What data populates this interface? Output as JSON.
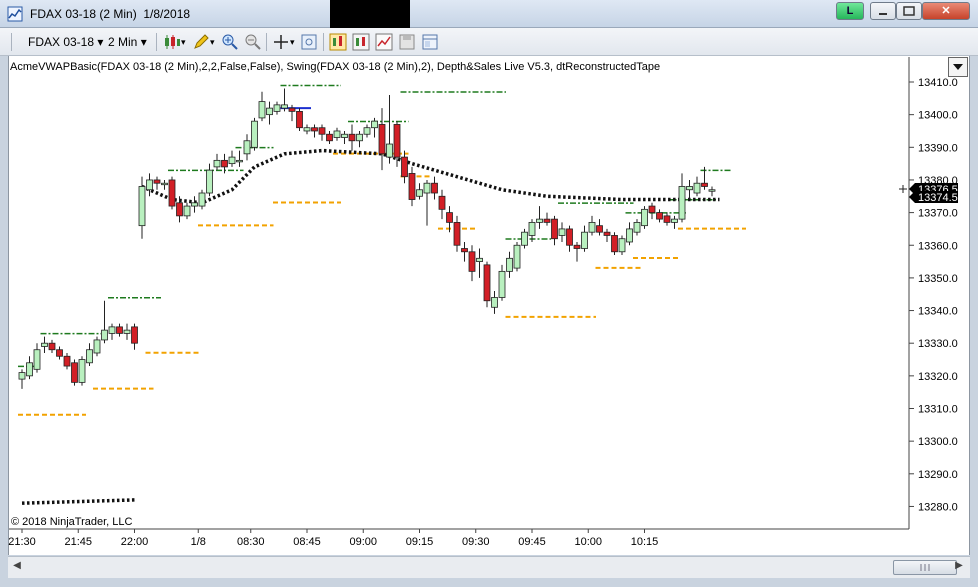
{
  "window": {
    "title": "FDAX 03-18 (2 Min)  1/8/2018",
    "link_button": "L",
    "min_icon": "minimize-icon",
    "max_icon": "maximize-icon",
    "close_label": "✕"
  },
  "toolbar": {
    "instrument": "FDAX 03-18",
    "interval": "2 Min",
    "icons": [
      "bar-type-icon",
      "draw-pencil-icon",
      "zoom-in-icon",
      "zoom-out-icon",
      "crosshair-icon",
      "properties-icon",
      "strategy-icon",
      "indicators-icon",
      "chart-trader-icon",
      "save-icon",
      "templates-icon"
    ]
  },
  "indicator_label": "AcmeVWAPBasic(FDAX 03-18 (2 Min),2,2,False,False), Swing(FDAX 03-18 (2 Min),2), Depth&Sales Live V5.3, dtReconstructedTape",
  "copyright": "© 2018 NinjaTrader, LLC",
  "colors": {
    "up_candle": "#b9f0bf",
    "down_candle": "#d21f26",
    "vwap": "#111111",
    "swing_high": "#1e7a1e",
    "swing_low": "#f2a200",
    "price_tag_bg": "#000000",
    "price_tag_fg": "#ffffff"
  },
  "chart_data": {
    "type": "candlestick",
    "title": "",
    "ylim": [
      13274,
      13414
    ],
    "yticks": [
      13280,
      13290,
      13300,
      13310,
      13320,
      13330,
      13340,
      13350,
      13360,
      13370,
      13380,
      13390,
      13400,
      13410
    ],
    "ytick_labels": [
      "13280.0",
      "13290.0",
      "13300.0",
      "13310.0",
      "13320.0",
      "13330.0",
      "13340.0",
      "13350.0",
      "13360.0",
      "13370.0",
      "13380.0",
      "13390.0",
      "13400.0",
      "13410.0"
    ],
    "xtick_labels": [
      "21:30",
      "21:45",
      "22:00",
      "1/8",
      "08:30",
      "08:45",
      "09:00",
      "09:15",
      "09:30",
      "09:45",
      "10:00",
      "10:15"
    ],
    "xtick_bars": [
      0,
      7.5,
      15,
      23.5,
      30.5,
      38,
      45.5,
      53,
      60.5,
      68,
      75.5,
      83
    ],
    "last_price_labels": [
      "13376.5",
      "13374.5"
    ],
    "candles": [
      {
        "o": 13319,
        "h": 13322,
        "l": 13316,
        "c": 13321
      },
      {
        "o": 13320,
        "h": 13326,
        "l": 13319,
        "c": 13324
      },
      {
        "o": 13322,
        "h": 13330,
        "l": 13321,
        "c": 13328
      },
      {
        "o": 13329,
        "h": 13332,
        "l": 13327,
        "c": 13330
      },
      {
        "o": 13330,
        "h": 13331,
        "l": 13327,
        "c": 13328
      },
      {
        "o": 13328,
        "h": 13329,
        "l": 13325,
        "c": 13326
      },
      {
        "o": 13326,
        "h": 13327,
        "l": 13322,
        "c": 13323
      },
      {
        "o": 13324,
        "h": 13325,
        "l": 13317,
        "c": 13318
      },
      {
        "o": 13318,
        "h": 13326,
        "l": 13317,
        "c": 13325
      },
      {
        "o": 13324,
        "h": 13330,
        "l": 13323,
        "c": 13328
      },
      {
        "o": 13327,
        "h": 13332,
        "l": 13326,
        "c": 13331
      },
      {
        "o": 13331,
        "h": 13343,
        "l": 13330,
        "c": 13334
      },
      {
        "o": 13333,
        "h": 13336,
        "l": 13331,
        "c": 13335
      },
      {
        "o": 13335,
        "h": 13336,
        "l": 13332,
        "c": 13333
      },
      {
        "o": 13333,
        "h": 13336,
        "l": 13331,
        "c": 13334
      },
      {
        "o": 13335,
        "h": 13336,
        "l": 13328,
        "c": 13330
      },
      {
        "o": 13366,
        "h": 13381,
        "l": 13362,
        "c": 13378
      },
      {
        "o": 13377,
        "h": 13382,
        "l": 13375,
        "c": 13380
      },
      {
        "o": 13380,
        "h": 13381,
        "l": 13377,
        "c": 13379
      },
      {
        "o": 13379,
        "h": 13380,
        "l": 13377,
        "c": 13379
      },
      {
        "o": 13380,
        "h": 13381,
        "l": 13371,
        "c": 13372
      },
      {
        "o": 13373,
        "h": 13375,
        "l": 13367,
        "c": 13369
      },
      {
        "o": 13369,
        "h": 13373,
        "l": 13368,
        "c": 13372
      },
      {
        "o": 13372,
        "h": 13375,
        "l": 13370,
        "c": 13373
      },
      {
        "o": 13372,
        "h": 13377,
        "l": 13371,
        "c": 13376
      },
      {
        "o": 13376,
        "h": 13385,
        "l": 13375,
        "c": 13383
      },
      {
        "o": 13384,
        "h": 13388,
        "l": 13383,
        "c": 13386
      },
      {
        "o": 13386,
        "h": 13388,
        "l": 13382,
        "c": 13384
      },
      {
        "o": 13385,
        "h": 13389,
        "l": 13384,
        "c": 13387
      },
      {
        "o": 13386,
        "h": 13389,
        "l": 13384,
        "c": 13386
      },
      {
        "o": 13388,
        "h": 13394,
        "l": 13386,
        "c": 13392
      },
      {
        "o": 13390,
        "h": 13399,
        "l": 13389,
        "c": 13398
      },
      {
        "o": 13399,
        "h": 13407,
        "l": 13398,
        "c": 13404
      },
      {
        "o": 13400,
        "h": 13404,
        "l": 13397,
        "c": 13402
      },
      {
        "o": 13401,
        "h": 13404,
        "l": 13400,
        "c": 13403
      },
      {
        "o": 13402,
        "h": 13408,
        "l": 13401,
        "c": 13403
      },
      {
        "o": 13402,
        "h": 13403,
        "l": 13398,
        "c": 13401
      },
      {
        "o": 13401,
        "h": 13402,
        "l": 13395,
        "c": 13396
      },
      {
        "o": 13395,
        "h": 13397,
        "l": 13394,
        "c": 13396
      },
      {
        "o": 13396,
        "h": 13397,
        "l": 13393,
        "c": 13395
      },
      {
        "o": 13396,
        "h": 13397,
        "l": 13392,
        "c": 13394
      },
      {
        "o": 13394,
        "h": 13395,
        "l": 13391,
        "c": 13392
      },
      {
        "o": 13393,
        "h": 13396,
        "l": 13392,
        "c": 13395
      },
      {
        "o": 13393,
        "h": 13395,
        "l": 13391,
        "c": 13394
      },
      {
        "o": 13394,
        "h": 13397,
        "l": 13389,
        "c": 13392
      },
      {
        "o": 13392,
        "h": 13395,
        "l": 13390,
        "c": 13394
      },
      {
        "o": 13394,
        "h": 13397,
        "l": 13393,
        "c": 13396
      },
      {
        "o": 13396,
        "h": 13399,
        "l": 13393,
        "c": 13398
      },
      {
        "o": 13397,
        "h": 13402,
        "l": 13383,
        "c": 13388
      },
      {
        "o": 13387,
        "h": 13406,
        "l": 13385,
        "c": 13391
      },
      {
        "o": 13397,
        "h": 13398,
        "l": 13384,
        "c": 13387
      },
      {
        "o": 13387,
        "h": 13389,
        "l": 13379,
        "c": 13381
      },
      {
        "o": 13382,
        "h": 13384,
        "l": 13372,
        "c": 13374
      },
      {
        "o": 13375,
        "h": 13379,
        "l": 13374,
        "c": 13377
      },
      {
        "o": 13376,
        "h": 13380,
        "l": 13366,
        "c": 13379
      },
      {
        "o": 13379,
        "h": 13381,
        "l": 13374,
        "c": 13376
      },
      {
        "o": 13375,
        "h": 13377,
        "l": 13368,
        "c": 13371
      },
      {
        "o": 13370,
        "h": 13372,
        "l": 13364,
        "c": 13367
      },
      {
        "o": 13367,
        "h": 13369,
        "l": 13358,
        "c": 13360
      },
      {
        "o": 13359,
        "h": 13361,
        "l": 13355,
        "c": 13358
      },
      {
        "o": 13358,
        "h": 13360,
        "l": 13349,
        "c": 13352
      },
      {
        "o": 13355,
        "h": 13359,
        "l": 13350,
        "c": 13356
      },
      {
        "o": 13354,
        "h": 13355,
        "l": 13341,
        "c": 13343
      },
      {
        "o": 13341,
        "h": 13346,
        "l": 13339,
        "c": 13344
      },
      {
        "o": 13344,
        "h": 13354,
        "l": 13343,
        "c": 13352
      },
      {
        "o": 13352,
        "h": 13358,
        "l": 13350,
        "c": 13356
      },
      {
        "o": 13353,
        "h": 13361,
        "l": 13352,
        "c": 13360
      },
      {
        "o": 13360,
        "h": 13365,
        "l": 13359,
        "c": 13364
      },
      {
        "o": 13363,
        "h": 13368,
        "l": 13361,
        "c": 13367
      },
      {
        "o": 13367,
        "h": 13372,
        "l": 13365,
        "c": 13368
      },
      {
        "o": 13368,
        "h": 13370,
        "l": 13366,
        "c": 13367
      },
      {
        "o": 13368,
        "h": 13369,
        "l": 13360,
        "c": 13362
      },
      {
        "o": 13363,
        "h": 13367,
        "l": 13361,
        "c": 13365
      },
      {
        "o": 13365,
        "h": 13366,
        "l": 13358,
        "c": 13360
      },
      {
        "o": 13360,
        "h": 13361,
        "l": 13355,
        "c": 13359
      },
      {
        "o": 13359,
        "h": 13366,
        "l": 13358,
        "c": 13364
      },
      {
        "o": 13364,
        "h": 13369,
        "l": 13363,
        "c": 13367
      },
      {
        "o": 13366,
        "h": 13368,
        "l": 13363,
        "c": 13364
      },
      {
        "o": 13364,
        "h": 13365,
        "l": 13361,
        "c": 13363
      },
      {
        "o": 13363,
        "h": 13364,
        "l": 13357,
        "c": 13358
      },
      {
        "o": 13358,
        "h": 13363,
        "l": 13357,
        "c": 13362
      },
      {
        "o": 13361,
        "h": 13367,
        "l": 13360,
        "c": 13365
      },
      {
        "o": 13364,
        "h": 13368,
        "l": 13363,
        "c": 13367
      },
      {
        "o": 13366,
        "h": 13372,
        "l": 13365,
        "c": 13371
      },
      {
        "o": 13372,
        "h": 13373,
        "l": 13368,
        "c": 13370
      },
      {
        "o": 13370,
        "h": 13371,
        "l": 13367,
        "c": 13368
      },
      {
        "o": 13369,
        "h": 13370,
        "l": 13366,
        "c": 13367
      },
      {
        "o": 13367,
        "h": 13369,
        "l": 13365,
        "c": 13368
      },
      {
        "o": 13368,
        "h": 13382,
        "l": 13367,
        "c": 13378
      },
      {
        "o": 13377,
        "h": 13380,
        "l": 13374,
        "c": 13378
      },
      {
        "o": 13376,
        "h": 13381,
        "l": 13375,
        "c": 13379
      },
      {
        "o": 13379,
        "h": 13384,
        "l": 13377,
        "c": 13378
      },
      {
        "o": 13377,
        "h": 13378,
        "l": 13375,
        "c": 13377
      }
    ],
    "vwap": [
      {
        "bar": 0,
        "v": 13281
      },
      {
        "bar": 15,
        "v": 13282
      },
      {
        "bar": 16,
        "v": 13378
      },
      {
        "bar": 20,
        "v": 13374
      },
      {
        "bar": 24,
        "v": 13373
      },
      {
        "bar": 28,
        "v": 13377
      },
      {
        "bar": 31,
        "v": 13384
      },
      {
        "bar": 35,
        "v": 13388
      },
      {
        "bar": 40,
        "v": 13389
      },
      {
        "bar": 48,
        "v": 13388
      },
      {
        "bar": 52,
        "v": 13385
      },
      {
        "bar": 58,
        "v": 13381
      },
      {
        "bar": 64,
        "v": 13377
      },
      {
        "bar": 70,
        "v": 13375
      },
      {
        "bar": 80,
        "v": 13374
      },
      {
        "bar": 93,
        "v": 13374
      }
    ],
    "swing_highs": [
      {
        "from": 0,
        "to": 2,
        "v": 13322
      },
      {
        "from": 3,
        "to": 10,
        "v": 13332
      },
      {
        "from": 12,
        "to": 18,
        "v": 13343
      },
      {
        "from": 20,
        "to": 29,
        "v": 13382
      },
      {
        "from": 29,
        "to": 33,
        "v": 13389
      },
      {
        "from": 35,
        "to": 42,
        "v": 13408
      },
      {
        "from": 44,
        "to": 51,
        "v": 13397
      },
      {
        "from": 51,
        "to": 64,
        "v": 13406
      },
      {
        "from": 65,
        "to": 70,
        "v": 13361
      },
      {
        "from": 72,
        "to": 81,
        "v": 13372
      },
      {
        "from": 81,
        "to": 88,
        "v": 13369
      },
      {
        "from": 87,
        "to": 92,
        "v": 13373
      },
      {
        "from": 91,
        "to": 94,
        "v": 13382
      }
    ],
    "swing_lows": [
      {
        "from": 0,
        "to": 8,
        "v": 13309
      },
      {
        "from": 10,
        "to": 17,
        "v": 13317
      },
      {
        "from": 17,
        "to": 23,
        "v": 13328
      },
      {
        "from": 24,
        "to": 33,
        "v": 13367
      },
      {
        "from": 34,
        "to": 42,
        "v": 13374
      },
      {
        "from": 42,
        "to": 51,
        "v": 13389
      },
      {
        "from": 51,
        "to": 54,
        "v": 13382
      },
      {
        "from": 56,
        "to": 60,
        "v": 13366
      },
      {
        "from": 65,
        "to": 76,
        "v": 13339
      },
      {
        "from": 77,
        "to": 82,
        "v": 13354
      },
      {
        "from": 82,
        "to": 87,
        "v": 13357
      },
      {
        "from": 88,
        "to": 96,
        "v": 13366
      }
    ],
    "marker_line": {
      "from": 35,
      "to": 38,
      "v": 13402
    }
  }
}
